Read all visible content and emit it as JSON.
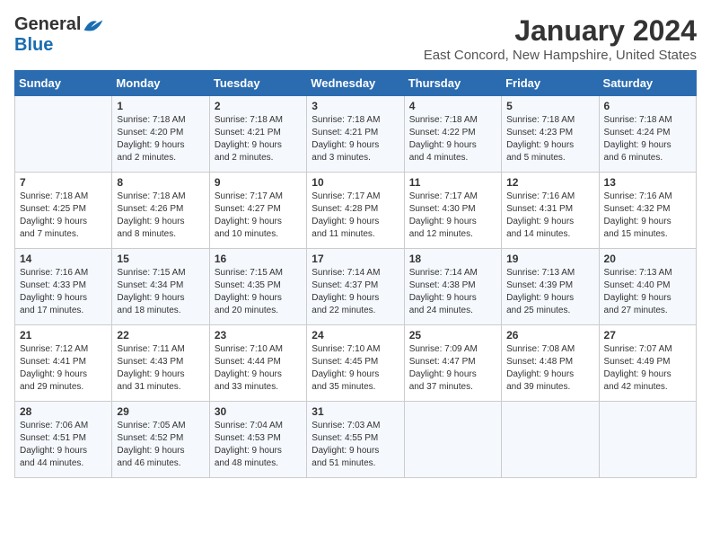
{
  "logo": {
    "line1": "General",
    "line2": "Blue"
  },
  "title": "January 2024",
  "subtitle": "East Concord, New Hampshire, United States",
  "days_of_week": [
    "Sunday",
    "Monday",
    "Tuesday",
    "Wednesday",
    "Thursday",
    "Friday",
    "Saturday"
  ],
  "weeks": [
    [
      {
        "day": "",
        "content": ""
      },
      {
        "day": "1",
        "content": "Sunrise: 7:18 AM\nSunset: 4:20 PM\nDaylight: 9 hours\nand 2 minutes."
      },
      {
        "day": "2",
        "content": "Sunrise: 7:18 AM\nSunset: 4:21 PM\nDaylight: 9 hours\nand 2 minutes."
      },
      {
        "day": "3",
        "content": "Sunrise: 7:18 AM\nSunset: 4:21 PM\nDaylight: 9 hours\nand 3 minutes."
      },
      {
        "day": "4",
        "content": "Sunrise: 7:18 AM\nSunset: 4:22 PM\nDaylight: 9 hours\nand 4 minutes."
      },
      {
        "day": "5",
        "content": "Sunrise: 7:18 AM\nSunset: 4:23 PM\nDaylight: 9 hours\nand 5 minutes."
      },
      {
        "day": "6",
        "content": "Sunrise: 7:18 AM\nSunset: 4:24 PM\nDaylight: 9 hours\nand 6 minutes."
      }
    ],
    [
      {
        "day": "7",
        "content": "Sunrise: 7:18 AM\nSunset: 4:25 PM\nDaylight: 9 hours\nand 7 minutes."
      },
      {
        "day": "8",
        "content": "Sunrise: 7:18 AM\nSunset: 4:26 PM\nDaylight: 9 hours\nand 8 minutes."
      },
      {
        "day": "9",
        "content": "Sunrise: 7:17 AM\nSunset: 4:27 PM\nDaylight: 9 hours\nand 10 minutes."
      },
      {
        "day": "10",
        "content": "Sunrise: 7:17 AM\nSunset: 4:28 PM\nDaylight: 9 hours\nand 11 minutes."
      },
      {
        "day": "11",
        "content": "Sunrise: 7:17 AM\nSunset: 4:30 PM\nDaylight: 9 hours\nand 12 minutes."
      },
      {
        "day": "12",
        "content": "Sunrise: 7:16 AM\nSunset: 4:31 PM\nDaylight: 9 hours\nand 14 minutes."
      },
      {
        "day": "13",
        "content": "Sunrise: 7:16 AM\nSunset: 4:32 PM\nDaylight: 9 hours\nand 15 minutes."
      }
    ],
    [
      {
        "day": "14",
        "content": "Sunrise: 7:16 AM\nSunset: 4:33 PM\nDaylight: 9 hours\nand 17 minutes."
      },
      {
        "day": "15",
        "content": "Sunrise: 7:15 AM\nSunset: 4:34 PM\nDaylight: 9 hours\nand 18 minutes."
      },
      {
        "day": "16",
        "content": "Sunrise: 7:15 AM\nSunset: 4:35 PM\nDaylight: 9 hours\nand 20 minutes."
      },
      {
        "day": "17",
        "content": "Sunrise: 7:14 AM\nSunset: 4:37 PM\nDaylight: 9 hours\nand 22 minutes."
      },
      {
        "day": "18",
        "content": "Sunrise: 7:14 AM\nSunset: 4:38 PM\nDaylight: 9 hours\nand 24 minutes."
      },
      {
        "day": "19",
        "content": "Sunrise: 7:13 AM\nSunset: 4:39 PM\nDaylight: 9 hours\nand 25 minutes."
      },
      {
        "day": "20",
        "content": "Sunrise: 7:13 AM\nSunset: 4:40 PM\nDaylight: 9 hours\nand 27 minutes."
      }
    ],
    [
      {
        "day": "21",
        "content": "Sunrise: 7:12 AM\nSunset: 4:41 PM\nDaylight: 9 hours\nand 29 minutes."
      },
      {
        "day": "22",
        "content": "Sunrise: 7:11 AM\nSunset: 4:43 PM\nDaylight: 9 hours\nand 31 minutes."
      },
      {
        "day": "23",
        "content": "Sunrise: 7:10 AM\nSunset: 4:44 PM\nDaylight: 9 hours\nand 33 minutes."
      },
      {
        "day": "24",
        "content": "Sunrise: 7:10 AM\nSunset: 4:45 PM\nDaylight: 9 hours\nand 35 minutes."
      },
      {
        "day": "25",
        "content": "Sunrise: 7:09 AM\nSunset: 4:47 PM\nDaylight: 9 hours\nand 37 minutes."
      },
      {
        "day": "26",
        "content": "Sunrise: 7:08 AM\nSunset: 4:48 PM\nDaylight: 9 hours\nand 39 minutes."
      },
      {
        "day": "27",
        "content": "Sunrise: 7:07 AM\nSunset: 4:49 PM\nDaylight: 9 hours\nand 42 minutes."
      }
    ],
    [
      {
        "day": "28",
        "content": "Sunrise: 7:06 AM\nSunset: 4:51 PM\nDaylight: 9 hours\nand 44 minutes."
      },
      {
        "day": "29",
        "content": "Sunrise: 7:05 AM\nSunset: 4:52 PM\nDaylight: 9 hours\nand 46 minutes."
      },
      {
        "day": "30",
        "content": "Sunrise: 7:04 AM\nSunset: 4:53 PM\nDaylight: 9 hours\nand 48 minutes."
      },
      {
        "day": "31",
        "content": "Sunrise: 7:03 AM\nSunset: 4:55 PM\nDaylight: 9 hours\nand 51 minutes."
      },
      {
        "day": "",
        "content": ""
      },
      {
        "day": "",
        "content": ""
      },
      {
        "day": "",
        "content": ""
      }
    ]
  ]
}
